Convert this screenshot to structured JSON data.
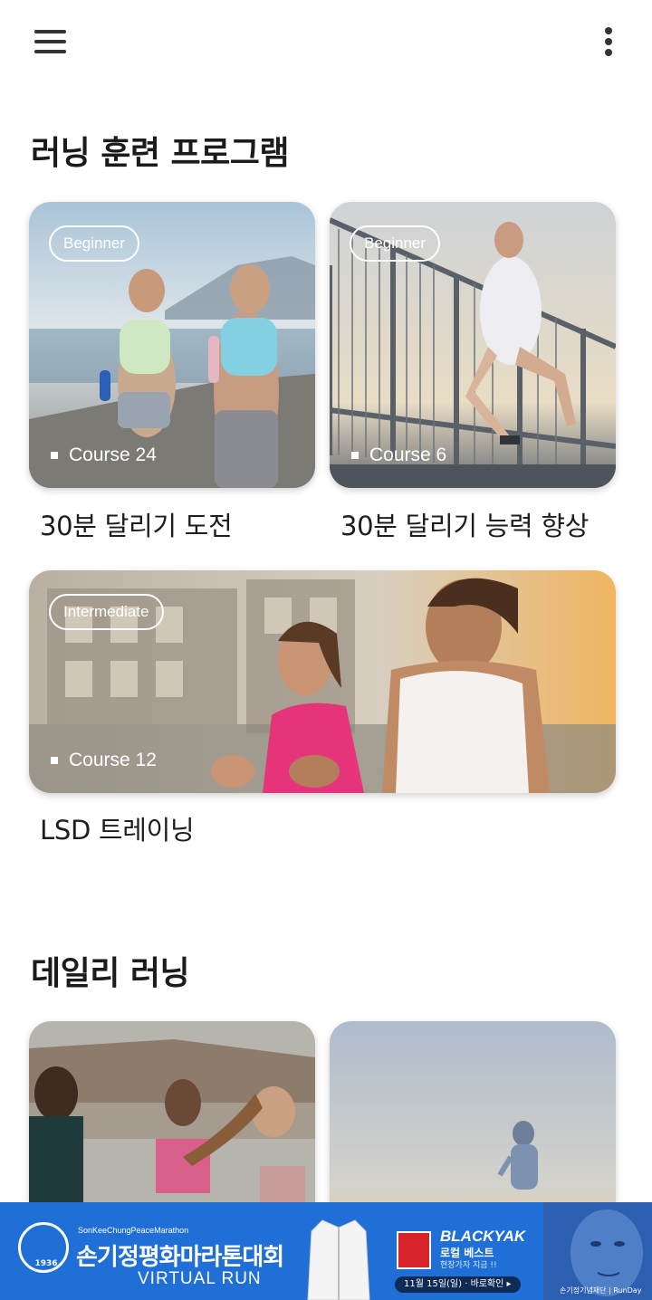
{
  "header": {
    "menu_icon": "hamburger-menu-icon",
    "more_icon": "more-vertical-icon"
  },
  "training": {
    "title": "러닝 훈련 프로그램",
    "programs": [
      {
        "level": "Beginner",
        "course": "Course 24",
        "name": "30분 달리기 도전"
      },
      {
        "level": "Beginner",
        "course": "Course 6",
        "name": "30분 달리기 능력 향상"
      },
      {
        "level": "Intermediate",
        "course": "Course 12",
        "name": "LSD 트레이닝"
      }
    ]
  },
  "daily": {
    "title": "데일리 러닝"
  },
  "ad": {
    "small_text": "SonKeeChungPeaceMarathon",
    "main_text": "손기정평화마라톤대회",
    "sub_text": "VIRTUAL RUN",
    "emblem_year": "1936",
    "brand": "BLACKYAK",
    "brand_sub": "로컬 베스트",
    "brand_sub2": "현장가자 지금 !!",
    "cta": "11월 15일(일) · 바로확인 ▸",
    "footer": "손기정기념재단 | RunDay"
  },
  "colors": {
    "ad_background": "#1f6fd6",
    "text": "#1d1d1d"
  }
}
